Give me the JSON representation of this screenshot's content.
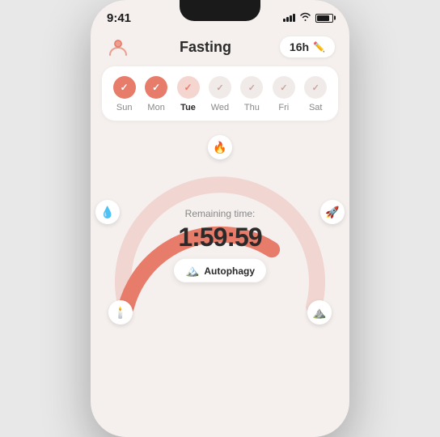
{
  "statusBar": {
    "time": "9:41",
    "battery": 75
  },
  "header": {
    "title": "Fasting",
    "duration": "16h",
    "editLabel": "✏️"
  },
  "days": [
    {
      "label": "Sun",
      "state": "filled",
      "bold": false
    },
    {
      "label": "Mon",
      "state": "filled",
      "bold": false
    },
    {
      "label": "Tue",
      "state": "light",
      "bold": true
    },
    {
      "label": "Wed",
      "state": "outline",
      "bold": false
    },
    {
      "label": "Thu",
      "state": "outline",
      "bold": false
    },
    {
      "label": "Fri",
      "state": "outline",
      "bold": false
    },
    {
      "label": "Sat",
      "state": "outline",
      "bold": false
    }
  ],
  "timer": {
    "remainingLabel": "Remaining time:",
    "time": "1:59:59",
    "stageName": "Autophagy"
  },
  "milestones": [
    {
      "icon": "🕯️",
      "angle": -155,
      "radius": 112
    },
    {
      "icon": "💧",
      "angle": -90,
      "radius": 112
    },
    {
      "icon": "🚀",
      "angle": -25,
      "radius": 112
    },
    {
      "icon": "🏔️",
      "angle": 25,
      "radius": 112
    },
    {
      "icon": "🕯️",
      "angle": 155,
      "radius": 112
    },
    {
      "icon": "⛰️",
      "angle": 90,
      "radius": 112
    }
  ],
  "colors": {
    "accent": "#e87c6a",
    "accentLight": "#f5d5d0",
    "arcColor": "#e87c6a",
    "arcBg": "#f5d5d0",
    "bg": "#f5f0ee"
  }
}
